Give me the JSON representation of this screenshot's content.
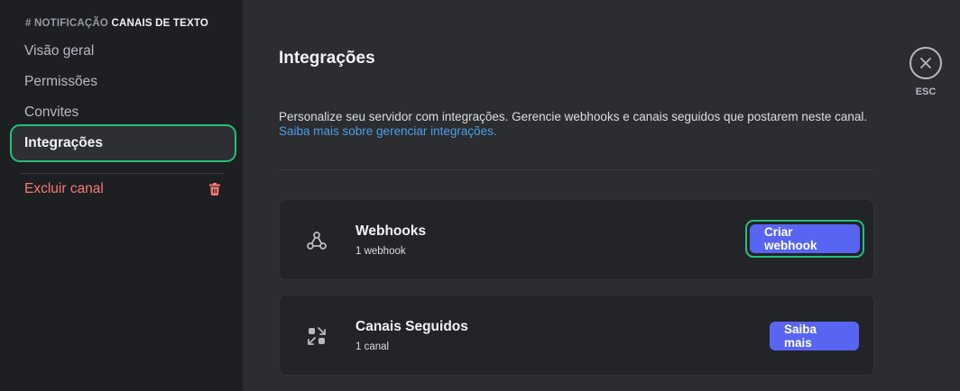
{
  "sidebar": {
    "header_hash": "#",
    "header_muted": "NOTIFICAÇÃO",
    "header_bold": "CANAIS DE TEXTO",
    "items": [
      {
        "label": "Visão geral"
      },
      {
        "label": "Permissões"
      },
      {
        "label": "Convites"
      },
      {
        "label": "Integrações",
        "active": true
      }
    ],
    "delete_label": "Excluir canal"
  },
  "main": {
    "title": "Integrações",
    "description": "Personalize seu servidor com integrações. Gerencie webhooks e canais seguidos que postarem neste canal.",
    "learn_more_link": "Saiba mais sobre gerenciar integrações.",
    "cards": [
      {
        "title": "Webhooks",
        "subtitle": "1 webhook",
        "button": "Criar webhook",
        "icon": "webhook-icon"
      },
      {
        "title": "Canais Seguidos",
        "subtitle": "1 canal",
        "button": "Saiba mais",
        "icon": "followed-channels-icon"
      }
    ]
  },
  "close": {
    "label": "ESC",
    "icon": "close-icon"
  },
  "colors": {
    "accent": "#5865f2",
    "highlight": "#23c07a",
    "danger": "#f47c72",
    "link": "#4b9ee8"
  }
}
